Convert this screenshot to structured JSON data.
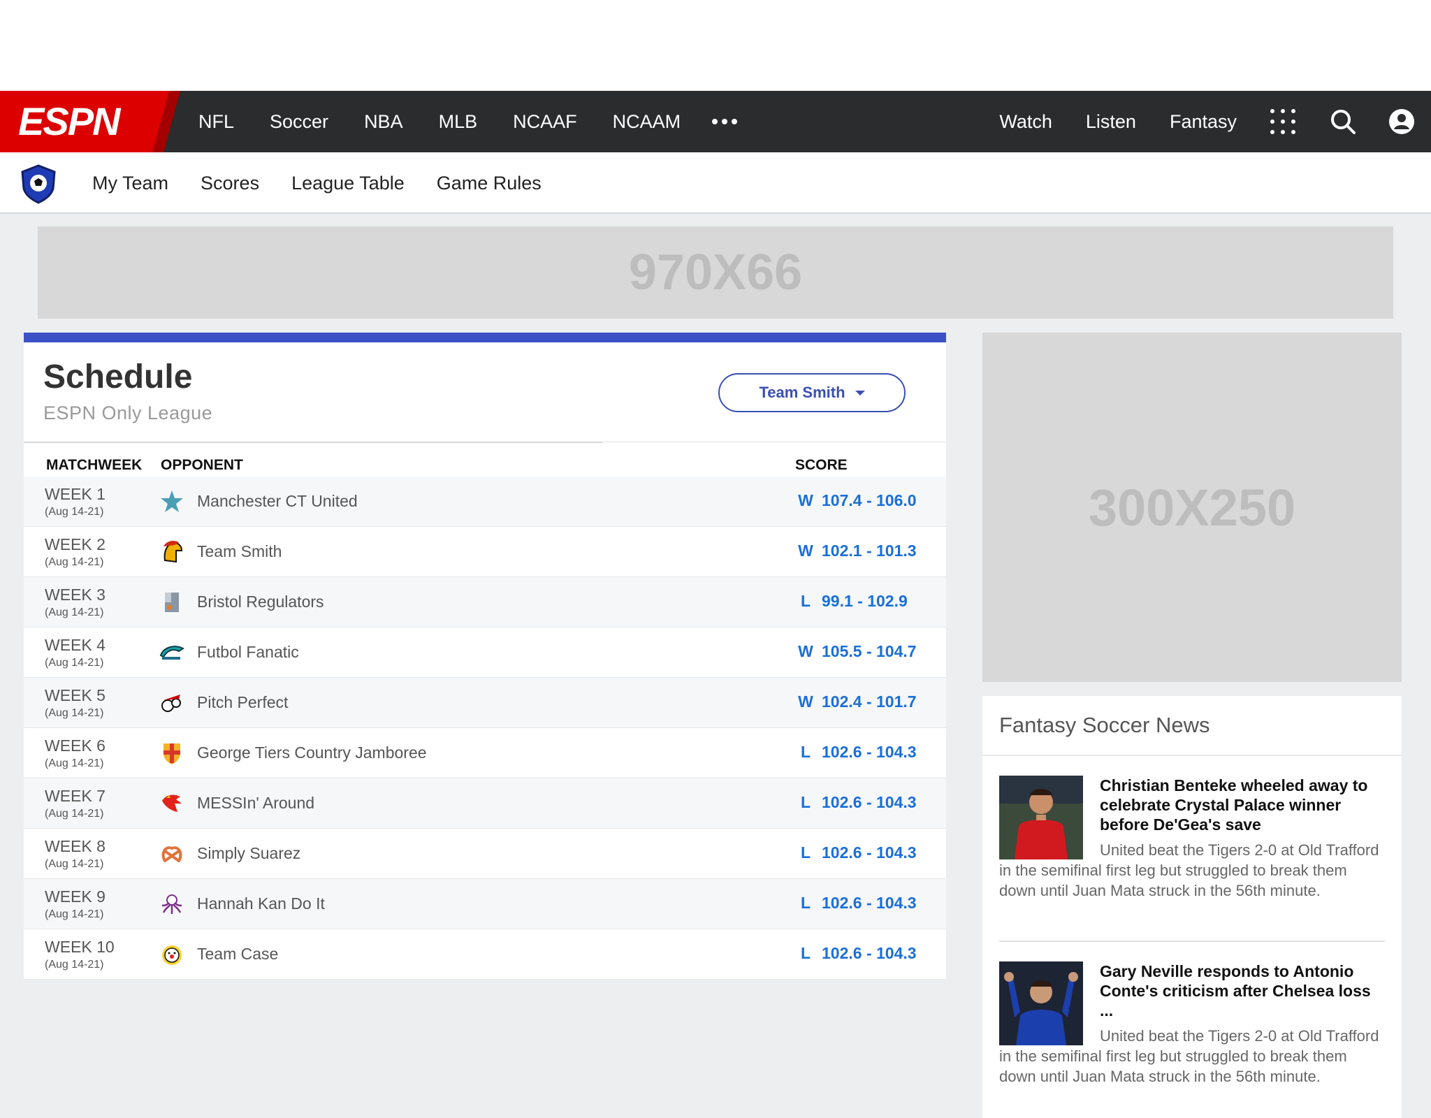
{
  "brand": {
    "logo_text": "ESPN"
  },
  "nav": {
    "left": [
      "NFL",
      "Soccer",
      "NBA",
      "MLB",
      "NCAAF",
      "NCAAM"
    ],
    "more_icon": "ellipsis-icon",
    "right": [
      "Watch",
      "Listen",
      "Fantasy"
    ],
    "icons": [
      "apps-grid-icon",
      "search-icon",
      "account-icon"
    ]
  },
  "subnav": {
    "badge_icon": "soccer-shield-icon",
    "items": [
      "My Team",
      "Scores",
      "League Table",
      "Game Rules"
    ]
  },
  "ads": {
    "banner": "970X66",
    "box": "300X250"
  },
  "schedule": {
    "title": "Schedule",
    "subtitle": "ESPN Only League",
    "team_select": "Team Smith",
    "headers": {
      "week": "MATCHWEEK",
      "opponent": "OPPONENT",
      "score": "SCORE"
    },
    "rows": [
      {
        "week": "WEEK 1",
        "dates": "(Aug 14-21)",
        "opponent": "Manchester CT United",
        "icon": "star-icon",
        "result": "W",
        "score": "107.4 - 106.0"
      },
      {
        "week": "WEEK 2",
        "dates": "(Aug 14-21)",
        "opponent": "Team Smith",
        "icon": "spartan-helmet-icon",
        "result": "W",
        "score": "102.1 - 101.3"
      },
      {
        "week": "WEEK 3",
        "dates": "(Aug 14-21)",
        "opponent": "Bristol Regulators",
        "icon": "tower-icon",
        "result": "L",
        "score": "99.1 - 102.9"
      },
      {
        "week": "WEEK 4",
        "dates": "(Aug 14-21)",
        "opponent": "Futbol Fanatic",
        "icon": "dolphin-icon",
        "result": "W",
        "score": "105.5 - 104.7"
      },
      {
        "week": "WEEK 5",
        "dates": "(Aug 14-21)",
        "opponent": "Pitch Perfect",
        "icon": "pirate-icon",
        "result": "W",
        "score": "102.4 - 101.7"
      },
      {
        "week": "WEEK 6",
        "dates": "(Aug 14-21)",
        "opponent": "George Tiers Country Jamboree",
        "icon": "cross-shield-icon",
        "result": "L",
        "score": "102.6 - 104.3"
      },
      {
        "week": "WEEK 7",
        "dates": "(Aug 14-21)",
        "opponent": "MESSIn' Around",
        "icon": "rooster-icon",
        "result": "L",
        "score": "102.6 - 104.3"
      },
      {
        "week": "WEEK 8",
        "dates": "(Aug 14-21)",
        "opponent": "Simply Suarez",
        "icon": "pretzel-icon",
        "result": "L",
        "score": "102.6 - 104.3"
      },
      {
        "week": "WEEK 9",
        "dates": "(Aug 14-21)",
        "opponent": "Hannah Kan Do It",
        "icon": "octopus-icon",
        "result": "L",
        "score": "102.6 - 104.3"
      },
      {
        "week": "WEEK 10",
        "dates": "(Aug 14-21)",
        "opponent": "Team Case",
        "icon": "clown-icon",
        "result": "L",
        "score": "102.6 - 104.3"
      }
    ]
  },
  "news": {
    "title": "Fantasy Soccer News",
    "stories": [
      {
        "headline": "Christian Benteke wheeled away to celebrate Crystal Palace winner before De'Gea's save",
        "blurb": "United beat the Tigers 2-0 at Old Trafford in the semifinal first leg but struggled to break them down until Juan Mata struck in the 56th minute.",
        "jersey_color": "#d11a1f"
      },
      {
        "headline": "Gary Neville responds to Antonio Conte's criticism after Chelsea loss ...",
        "blurb": "United beat the Tigers 2-0 at Old Trafford in the semifinal first leg but struggled to break them down until Juan Mata struck in the 56th minute.",
        "jersey_color": "#1c3fae"
      }
    ]
  }
}
